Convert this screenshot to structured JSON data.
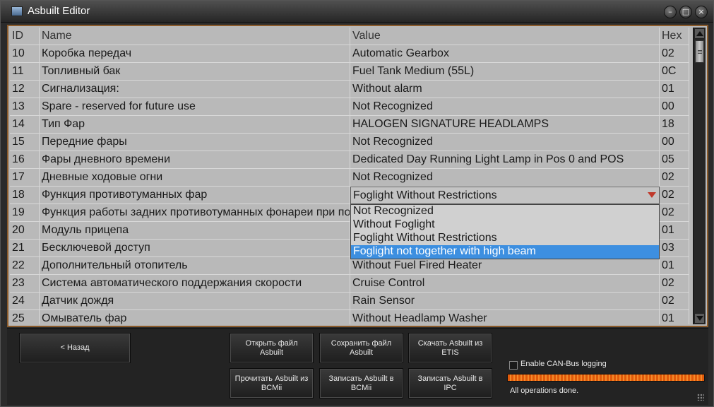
{
  "window": {
    "title": "Asbuilt Editor",
    "icon": "app-icon",
    "controls": [
      "minimize",
      "maximize",
      "close"
    ]
  },
  "grid": {
    "columns": {
      "id": "ID",
      "name": "Name",
      "value": "Value",
      "hex": "Hex"
    },
    "rows": [
      {
        "id": "10",
        "name": "Коробка передач",
        "value": "Automatic Gearbox",
        "hex": "02"
      },
      {
        "id": "11",
        "name": "Топливный бак",
        "value": "Fuel Tank Medium (55L)",
        "hex": "0C"
      },
      {
        "id": "12",
        "name": "Сигнализация:",
        "value": "Without alarm",
        "hex": "01"
      },
      {
        "id": "13",
        "name": "Spare - reserved for future use",
        "value": "Not Recognized",
        "hex": "00"
      },
      {
        "id": "14",
        "name": "Тип Фар",
        "value": "HALOGEN SIGNATURE HEADLAMPS",
        "hex": "18"
      },
      {
        "id": "15",
        "name": "Передние фары",
        "value": "Not Recognized",
        "hex": "00"
      },
      {
        "id": "16",
        "name": "Фары дневного времени",
        "value": "Dedicated Day Running Light Lamp in Pos 0 and POS",
        "hex": "05"
      },
      {
        "id": "17",
        "name": "Дневные ходовые огни",
        "value": "Not Recognized",
        "hex": "02"
      },
      {
        "id": "18",
        "name": "Функция противотуманных фар",
        "value": "Foglight Without Restrictions",
        "hex": "02"
      },
      {
        "id": "19",
        "name": "Функция работы задних противотуманных фонареи при подключенном прицепе",
        "value": "",
        "hex": "02"
      },
      {
        "id": "20",
        "name": "Модуль прицепа",
        "value": "",
        "hex": "01"
      },
      {
        "id": "21",
        "name": "Бесключевой доступ",
        "value": "",
        "hex": "03"
      },
      {
        "id": "22",
        "name": "Дополнительный отопитель",
        "value": "Without Fuel Fired Heater",
        "hex": "01"
      },
      {
        "id": "23",
        "name": "Система автоматического поддержания скорости",
        "value": "Cruise Control",
        "hex": "02"
      },
      {
        "id": "24",
        "name": "Датчик дождя",
        "value": "Rain Sensor",
        "hex": "02"
      },
      {
        "id": "25",
        "name": "Омыватель фар",
        "value": "Without Headlamp Washer",
        "hex": "01"
      }
    ],
    "editing_row_index": 8,
    "combo": {
      "value": "Foglight Without Restrictions",
      "arrow_icon": "chevron-down-icon",
      "arrow_color": "#c0392b",
      "options": [
        "Not Recognized",
        "Without Foglight",
        "Foglight Without Restrictions",
        "Foglight not together with high beam"
      ],
      "highlighted_index": 3
    }
  },
  "buttons": {
    "back": "< Назад",
    "open_file": "Открыть файл Asbuilt",
    "save_file": "Сохранить файл Asbuilt",
    "download_etis": "Скачать Asbuilt из ETIS",
    "read_bcmii": "Прочитать Asbuilt из BCMii",
    "write_bcmii": "Записать Asbuilt в BCMii",
    "write_ipc": "Записать Asbuilt в IPC"
  },
  "logging": {
    "checkbox_label": "Enable CAN-Bus logging",
    "checked": false
  },
  "progress": {
    "percent": 100,
    "color": "#e05a0a"
  },
  "status": "All operations done.",
  "colors": {
    "accent_border": "#8a5a2a",
    "selection": "#3d8fe0"
  }
}
